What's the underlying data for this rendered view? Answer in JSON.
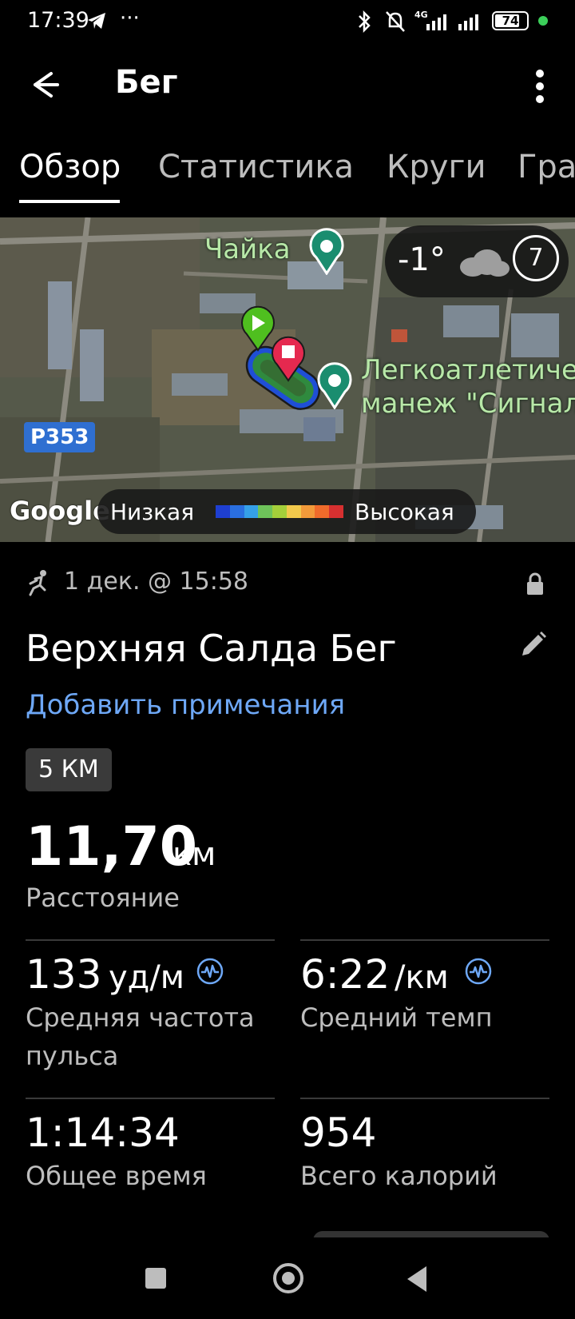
{
  "status_bar": {
    "time": "17:39",
    "battery": "74",
    "network": "4G",
    "icons": [
      "telegram-icon",
      "more-dots-icon",
      "bluetooth-icon",
      "muted-bell-icon",
      "signal-icon",
      "battery-icon",
      "green-dot-icon"
    ]
  },
  "app_bar": {
    "title": "Бег",
    "back_icon": "arrow-left-icon",
    "menu_icon": "more-vertical-icon"
  },
  "tabs": [
    {
      "label": "Обзор",
      "active": true
    },
    {
      "label": "Статистика",
      "active": false
    },
    {
      "label": "Круги",
      "active": false
    },
    {
      "label": "Графики",
      "active": false
    }
  ],
  "map": {
    "poi_1": "Чайка",
    "poi_2_line1": "Легкоатлетический",
    "poi_2_line2": "манеж \"Сигнал\"",
    "road_label": "Р353",
    "weather_temp": "-1°",
    "weather_wind": "7",
    "provider": "Google",
    "legend_low": "Низкая",
    "legend_high": "Высокая",
    "legend_colors": [
      "#1e3fd1",
      "#2a6fe0",
      "#35a0e8",
      "#6ec35a",
      "#a4cf3a",
      "#f2c94c",
      "#f29a3a",
      "#ef6b2b",
      "#d63030"
    ]
  },
  "activity": {
    "meta": "1 дек. @ 15:58",
    "name": "Верхняя Салда Бег",
    "add_notes": "Добавить примечания",
    "badge": "5 КМ",
    "distance_value": "11,70",
    "distance_unit": "км",
    "distance_label": "Расстояние",
    "hr_value": "133",
    "hr_unit": "уд/м",
    "hr_label_1": "Средняя частота",
    "hr_label_2": "пульса",
    "pace_value": "6:22",
    "pace_unit": "/км",
    "pace_label": "Средний темп",
    "time_value": "1:14:34",
    "time_label": "Общее время",
    "calories_value": "954",
    "calories_label": "Всего калорий",
    "accent_color": "#6ea8f7"
  }
}
